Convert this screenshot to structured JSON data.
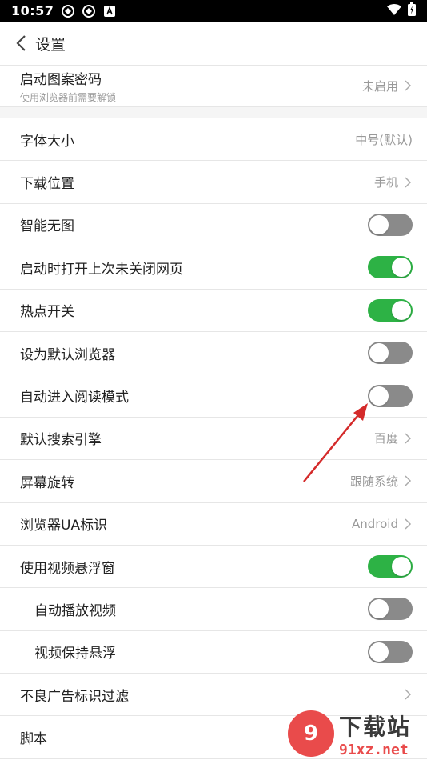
{
  "statusbar": {
    "time": "10:57",
    "icons": [
      "app-icon",
      "app-icon",
      "notification-a-icon"
    ],
    "right_icons": [
      "wifi-icon",
      "battery-icon"
    ]
  },
  "header": {
    "title": "设置"
  },
  "pattern_lock": {
    "label": "启动图案密码",
    "desc": "使用浏览器前需要解锁",
    "value": "未启用"
  },
  "settings": {
    "font_size": {
      "label": "字体大小",
      "value": "中号(默认)"
    },
    "download_location": {
      "label": "下载位置",
      "value": "手机"
    },
    "smart_no_image": {
      "label": "智能无图",
      "enabled": false
    },
    "restore_tabs": {
      "label": "启动时打开上次未关闭网页",
      "enabled": true
    },
    "hotspot": {
      "label": "热点开关",
      "enabled": true
    },
    "default_browser": {
      "label": "设为默认浏览器",
      "enabled": false
    },
    "auto_reading_mode": {
      "label": "自动进入阅读模式",
      "enabled": false
    },
    "search_engine": {
      "label": "默认搜索引擎",
      "value": "百度"
    },
    "screen_rotation": {
      "label": "屏幕旋转",
      "value": "跟随系统"
    },
    "user_agent": {
      "label": "浏览器UA标识",
      "value": "Android"
    },
    "video_float": {
      "label": "使用视频悬浮窗",
      "enabled": true
    },
    "autoplay_video": {
      "label": "自动播放视频",
      "enabled": false
    },
    "keep_video_float": {
      "label": "视频保持悬浮",
      "enabled": false
    },
    "ad_filter": {
      "label": "不良广告标识过滤"
    },
    "scripts": {
      "label": "脚本"
    }
  },
  "colors": {
    "toggle_on": "#2db245",
    "toggle_off": "#8a8a8a",
    "annotation_arrow": "#d42a2a"
  },
  "watermark": {
    "logo": "9",
    "main": "下载站",
    "sub": "91xz.net"
  }
}
